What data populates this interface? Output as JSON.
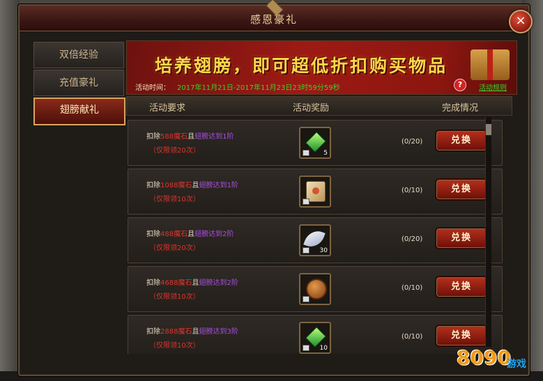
{
  "window": {
    "title": "感恩豪礼",
    "close_glyph": "×"
  },
  "tabs": [
    {
      "label": "双倍经验",
      "active": false
    },
    {
      "label": "充值豪礼",
      "active": false
    },
    {
      "label": "翅膀献礼",
      "active": true
    }
  ],
  "banner": {
    "headline": "培养翅膀，即可超低折扣购买物品",
    "time_label": "活动时间：",
    "time_value": "2017年11月21日-2017年11月23日23时59分59秒",
    "rules_label": "活动规则"
  },
  "table": {
    "headers": [
      "活动要求",
      "活动奖励",
      "完成情况"
    ],
    "rows": [
      {
        "prefix": "扣除",
        "cost": "588魔石",
        "mid": "且",
        "cond": "翅膀达到1阶",
        "limit": "（仅限领20次）",
        "reward_icon": "green-gem-icon",
        "reward_count": "5",
        "progress": "(0/20)",
        "button": "兑换"
      },
      {
        "prefix": "扣除",
        "cost": "1088魔石",
        "mid": "且",
        "cond": "翅膀达到1阶",
        "limit": "（仅限领10次）",
        "reward_icon": "scroll-icon",
        "reward_count": "",
        "progress": "(0/10)",
        "button": "兑换"
      },
      {
        "prefix": "扣除",
        "cost": "488魔石",
        "mid": "且",
        "cond": "翅膀达到2阶",
        "limit": "（仅限领20次）",
        "reward_icon": "feather-icon",
        "reward_count": "30",
        "progress": "(0/20)",
        "button": "兑换"
      },
      {
        "prefix": "扣除",
        "cost": "4688魔石",
        "mid": "且",
        "cond": "翅膀达到2阶",
        "limit": "（仅限领10次）",
        "reward_icon": "bronze-medal-icon",
        "reward_count": "",
        "progress": "(0/10)",
        "button": "兑换"
      },
      {
        "prefix": "扣除",
        "cost": "2888魔石",
        "mid": "且",
        "cond": "翅膀达到3阶",
        "limit": "（仅限领10次）",
        "reward_icon": "green-gem-icon",
        "reward_count": "10",
        "progress": "(0/10)",
        "button": "兑换"
      }
    ]
  },
  "watermark": {
    "brand_number": "8090",
    "brand_text": "游戏"
  }
}
